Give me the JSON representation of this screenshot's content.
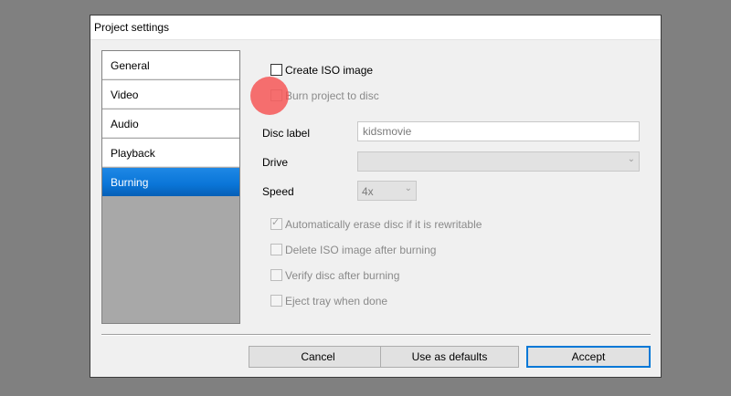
{
  "window": {
    "title": "Project settings"
  },
  "sidebar": {
    "items": [
      {
        "label": "General",
        "active": false
      },
      {
        "label": "Video",
        "active": false
      },
      {
        "label": "Audio",
        "active": false
      },
      {
        "label": "Playback",
        "active": false
      },
      {
        "label": "Burning",
        "active": true
      }
    ]
  },
  "burning": {
    "create_iso": {
      "label": "Create ISO image",
      "checked": false,
      "enabled": true
    },
    "burn_to_disc": {
      "label": "Burn project to disc",
      "checked": false,
      "enabled": false
    },
    "disc_label": {
      "label": "Disc label",
      "value": "kidsmovie"
    },
    "drive": {
      "label": "Drive",
      "value": ""
    },
    "speed": {
      "label": "Speed",
      "value": "4x"
    },
    "options": [
      {
        "label": "Automatically erase disc if it is rewritable",
        "checked": true,
        "enabled": false
      },
      {
        "label": "Delete ISO image after burning",
        "checked": false,
        "enabled": false
      },
      {
        "label": "Verify disc after burning",
        "checked": false,
        "enabled": false
      },
      {
        "label": "Eject tray when done",
        "checked": false,
        "enabled": false
      }
    ]
  },
  "buttons": {
    "cancel": "Cancel",
    "use_as_defaults": "Use as defaults",
    "accept": "Accept"
  },
  "colors": {
    "accent": "#0078d7",
    "active_item": "#0a76d8",
    "cursor_indicator": "#f55050"
  }
}
